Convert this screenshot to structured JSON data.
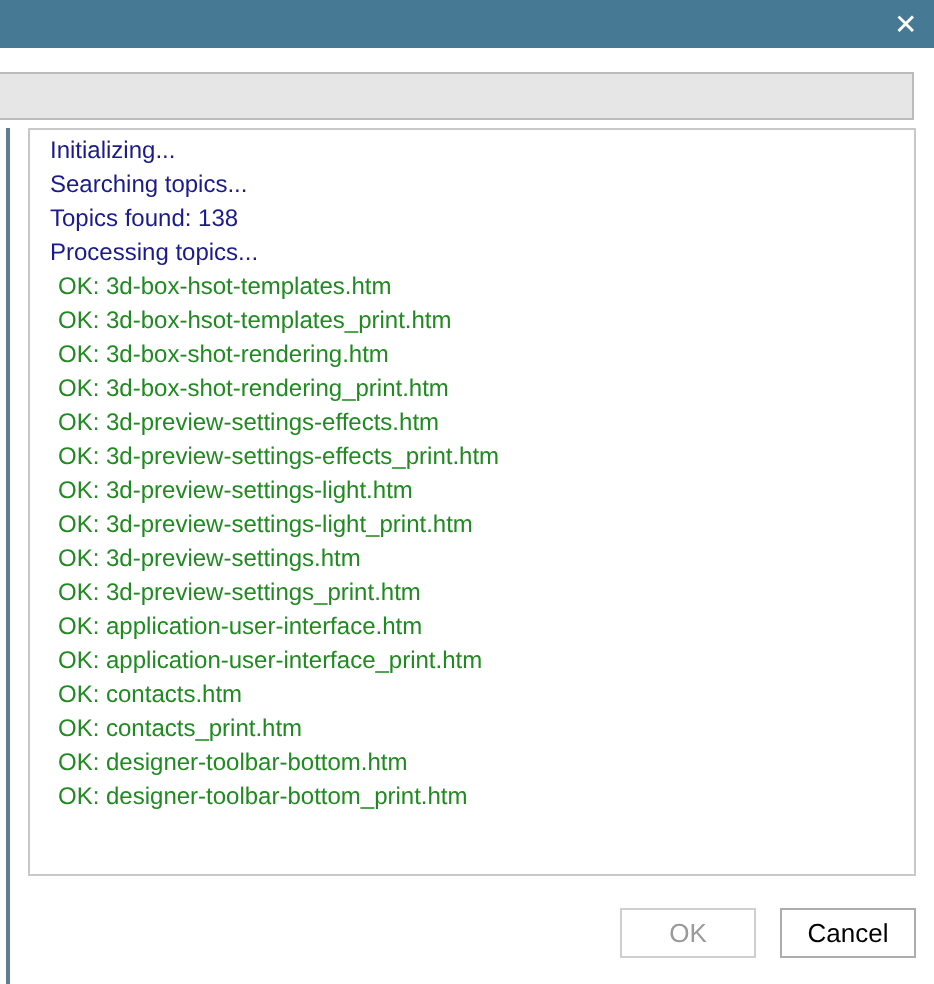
{
  "window": {
    "close_glyph": "✕"
  },
  "progress": {
    "level": 0
  },
  "log": [
    {
      "kind": "status",
      "text": "Initializing..."
    },
    {
      "kind": "status",
      "text": "Searching topics..."
    },
    {
      "kind": "status",
      "text": "Topics found: 138"
    },
    {
      "kind": "status",
      "text": "Processing topics..."
    },
    {
      "kind": "ok",
      "text": "OK: 3d-box-hsot-templates.htm"
    },
    {
      "kind": "ok",
      "text": "OK: 3d-box-hsot-templates_print.htm"
    },
    {
      "kind": "ok",
      "text": "OK: 3d-box-shot-rendering.htm"
    },
    {
      "kind": "ok",
      "text": "OK: 3d-box-shot-rendering_print.htm"
    },
    {
      "kind": "ok",
      "text": "OK: 3d-preview-settings-effects.htm"
    },
    {
      "kind": "ok",
      "text": "OK: 3d-preview-settings-effects_print.htm"
    },
    {
      "kind": "ok",
      "text": "OK: 3d-preview-settings-light.htm"
    },
    {
      "kind": "ok",
      "text": "OK: 3d-preview-settings-light_print.htm"
    },
    {
      "kind": "ok",
      "text": "OK: 3d-preview-settings.htm"
    },
    {
      "kind": "ok",
      "text": "OK: 3d-preview-settings_print.htm"
    },
    {
      "kind": "ok",
      "text": "OK: application-user-interface.htm"
    },
    {
      "kind": "ok",
      "text": "OK: application-user-interface_print.htm"
    },
    {
      "kind": "ok",
      "text": "OK: contacts.htm"
    },
    {
      "kind": "ok",
      "text": "OK: contacts_print.htm"
    },
    {
      "kind": "ok",
      "text": "OK: designer-toolbar-bottom.htm"
    },
    {
      "kind": "ok",
      "text": "OK: designer-toolbar-bottom_print.htm"
    }
  ],
  "buttons": [
    {
      "label": "OK",
      "disabled": true
    },
    {
      "label": "Cancel",
      "disabled": false
    }
  ]
}
